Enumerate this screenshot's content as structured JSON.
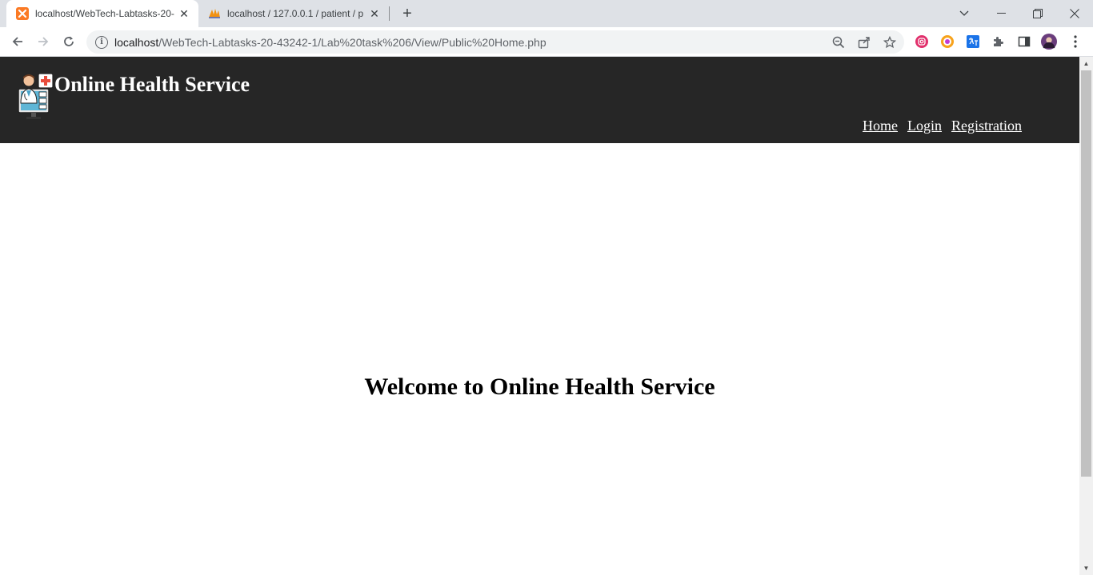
{
  "browser": {
    "tabs": [
      {
        "title": "localhost/WebTech-Labtasks-20-",
        "favicon": "xampp-icon",
        "active": true
      },
      {
        "title": "localhost / 127.0.0.1 / patient / p",
        "favicon": "phpmyadmin-icon",
        "active": false
      }
    ],
    "url": {
      "host": "localhost",
      "path": "/WebTech-Labtasks-20-43242-1/Lab%20task%206/View/Public%20Home.php"
    },
    "new_tab_glyph": "+",
    "close_glyph": "✕"
  },
  "site": {
    "title": "Online Health Service",
    "logo": "doctor-logo-icon",
    "nav": {
      "home": "Home",
      "login": "Login",
      "registration": "Registration"
    },
    "welcome": "Welcome to Online Health Service"
  },
  "colors": {
    "header_bg": "#262626",
    "header_text": "#ffffff",
    "tabstrip_bg": "#dee1e6"
  }
}
